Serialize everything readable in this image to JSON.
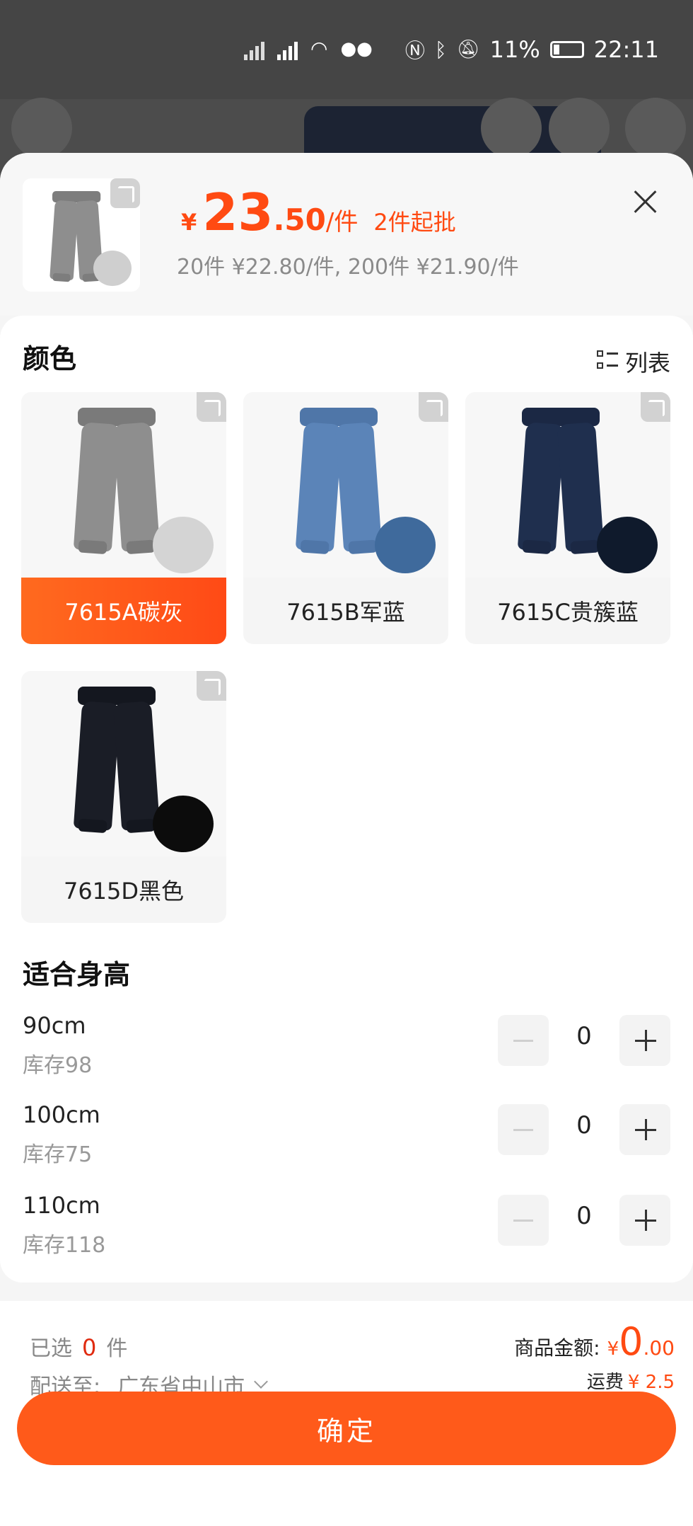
{
  "status_bar": {
    "battery": "11%",
    "time": "22:11"
  },
  "header": {
    "currency": "¥",
    "price_int": "23",
    "price_dec": ".50",
    "price_unit": "/件",
    "moq": "2件起批",
    "tiers": "20件 ¥22.80/件, 200件 ¥21.90/件"
  },
  "color_section": {
    "title": "颜色",
    "list_toggle": "列表",
    "options": [
      {
        "label": "7615A碳灰",
        "selected": true,
        "color": "#8e8e8e"
      },
      {
        "label": "7615B军蓝",
        "selected": false,
        "color": "#5b84b8"
      },
      {
        "label": "7615C贵簇蓝",
        "selected": false,
        "color": "#1f2f4e"
      },
      {
        "label": "7615D黑色",
        "selected": false,
        "color": "#1a1d26"
      }
    ]
  },
  "size_section": {
    "title": "适合身高",
    "rows": [
      {
        "name": "90cm",
        "stock": "库存98",
        "qty": "0"
      },
      {
        "name": "100cm",
        "stock": "库存75",
        "qty": "0"
      },
      {
        "name": "110cm",
        "stock": "库存118",
        "qty": "0"
      }
    ]
  },
  "footer": {
    "selected_prefix": "已选",
    "selected_count": "0",
    "selected_suffix": "件",
    "ship_label": "配送至:",
    "ship_location": "广东省中山市",
    "amount_label": "商品金额:",
    "amount_currency": "¥",
    "amount_int": "0",
    "amount_dec": ".00",
    "freight_label": "运费",
    "freight_value": "¥ 2.5",
    "confirm": "确定"
  },
  "colors": {
    "accent": "#ff5a1a",
    "price": "#ff4a12"
  }
}
